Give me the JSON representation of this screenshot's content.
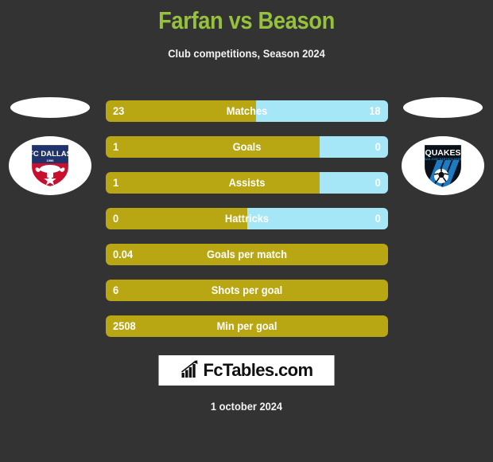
{
  "header": {
    "title": "Farfan vs Beason",
    "subtitle": "Club competitions, Season 2024",
    "title_color": "#96C13D",
    "subtitle_color": "#f2f2f2"
  },
  "teams": {
    "home": {
      "name": "FC Dallas",
      "badge_icon": "fc-dallas-badge-icon",
      "bar_color": "#B8A712"
    },
    "away": {
      "name": "Quakes",
      "badge_icon": "san-jose-quakes-badge-icon",
      "bar_color": "#A6E7F7"
    }
  },
  "footer": {
    "brand": "FcTables.com",
    "brand_icon": "bar-chart-growth-icon",
    "date": "1 october 2024"
  },
  "colors": {
    "background": "#333333",
    "home_bar": "#B8A712",
    "away_bar": "#A6E7F7",
    "text": "#ffffff",
    "accent": "#96C13D"
  },
  "chart_data": {
    "type": "bar",
    "title": "Farfan vs Beason",
    "subtitle": "Club competitions, Season 2024",
    "xlabel": "",
    "ylabel": "",
    "grid": false,
    "legend_position": "sides",
    "orientation": "horizontal-diverging",
    "categories": [
      "Matches",
      "Goals",
      "Assists",
      "Hattricks",
      "Goals per match",
      "Shots per goal",
      "Min per goal"
    ],
    "series": [
      {
        "name": "Farfan",
        "team": "FC Dallas",
        "color": "#B8A712",
        "values": [
          23,
          1,
          1,
          0,
          0.04,
          6,
          2508
        ],
        "labels": [
          "23",
          "1",
          "1",
          "0",
          "0.04",
          "6",
          "2508"
        ]
      },
      {
        "name": "Beason",
        "team": "Quakes",
        "color": "#A6E7F7",
        "values": [
          18,
          0,
          0,
          0,
          null,
          null,
          null
        ],
        "labels": [
          "18",
          "0",
          "0",
          "0",
          "",
          "",
          ""
        ]
      }
    ],
    "rows": [
      {
        "label": "Matches",
        "home": "23",
        "away": "18",
        "home_pct": 53.2,
        "two_sided": true
      },
      {
        "label": "Goals",
        "home": "1",
        "away": "0",
        "home_pct": 75.8,
        "two_sided": true
      },
      {
        "label": "Assists",
        "home": "1",
        "away": "0",
        "home_pct": 75.8,
        "two_sided": true
      },
      {
        "label": "Hattricks",
        "home": "0",
        "away": "0",
        "home_pct": 50.0,
        "two_sided": true
      },
      {
        "label": "Goals per match",
        "home": "0.04",
        "away": "",
        "home_pct": 100,
        "two_sided": false
      },
      {
        "label": "Shots per goal",
        "home": "6",
        "away": "",
        "home_pct": 100,
        "two_sided": false
      },
      {
        "label": "Min per goal",
        "home": "2508",
        "away": "",
        "home_pct": 100,
        "two_sided": false
      }
    ]
  }
}
